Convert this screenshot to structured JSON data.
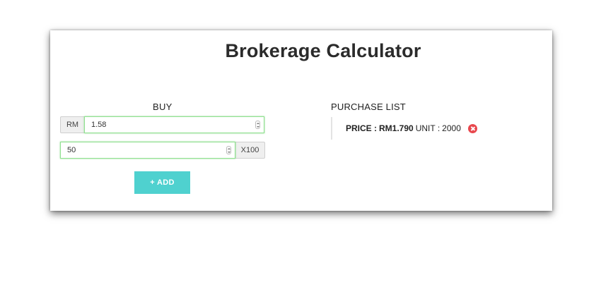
{
  "title": "Brokerage Calculator",
  "buy": {
    "heading": "BUY",
    "currency_label": "RM",
    "price_value": "1.58",
    "quantity_value": "50",
    "multiplier_label": "X100",
    "add_label": "+ ADD"
  },
  "purchase_list": {
    "heading": "PURCHASE LIST",
    "items": [
      {
        "price_label": "PRICE :",
        "price_value": "RM1.790",
        "unit_label": "UNIT :",
        "unit_value": "2000",
        "remove_icon": "close-circle-icon"
      }
    ]
  },
  "colors": {
    "accent": "#4fd1cf",
    "input_focus": "#8fe08f",
    "remove": "#e8474d"
  }
}
